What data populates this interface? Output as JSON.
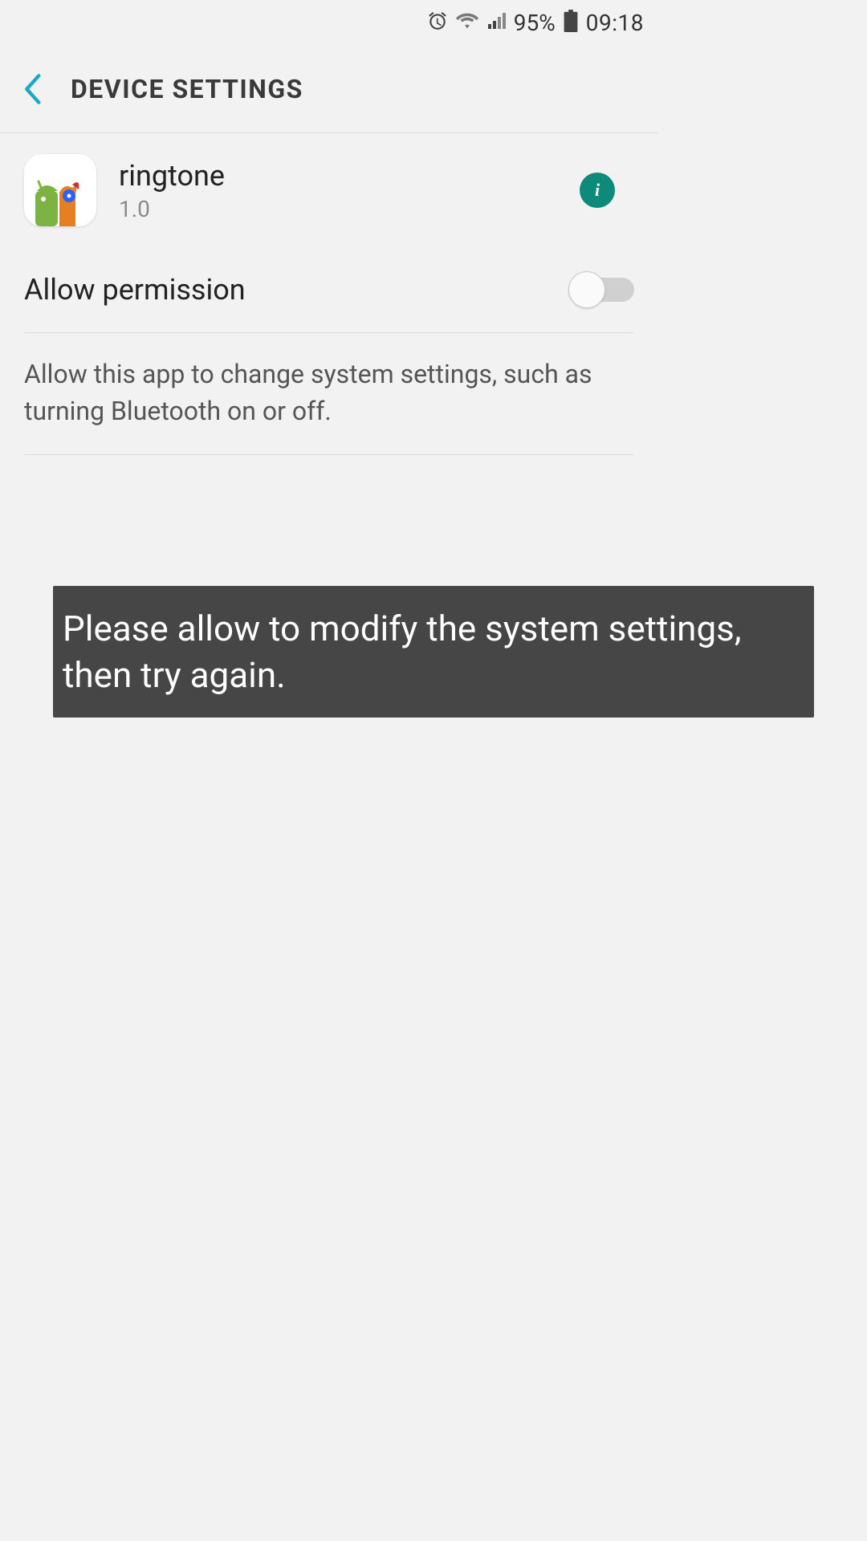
{
  "status": {
    "battery_pct": "95%",
    "time": "09:18"
  },
  "header": {
    "title": "DEVICE SETTINGS"
  },
  "app": {
    "name": "ringtone",
    "version": "1.0",
    "info_glyph": "i"
  },
  "permission": {
    "label": "Allow permission",
    "enabled": false,
    "description": "Allow this app to change system settings, such as turning Bluetooth on or off."
  },
  "toast": {
    "message": "Please allow to modify the system settings, then try again."
  },
  "icons": {
    "alarm": "alarm-icon",
    "wifi": "wifi-icon",
    "signal": "signal-icon",
    "battery": "battery-icon",
    "back": "chevron-left-icon",
    "info": "info-icon"
  }
}
